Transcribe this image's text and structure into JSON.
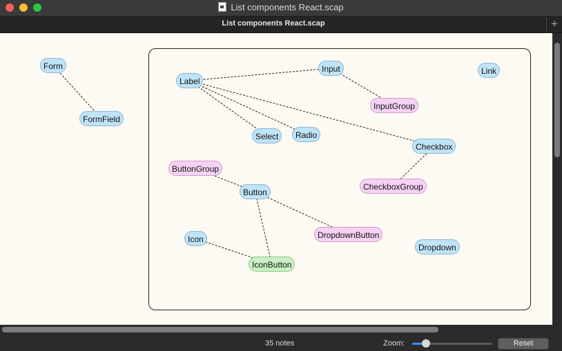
{
  "window": {
    "title": "List components React.scap",
    "controls": {
      "close": "#ff5f57",
      "minimize": "#febc2e",
      "maximize": "#28c840"
    }
  },
  "tabs": [
    {
      "label": "List components React.scap",
      "active": true
    }
  ],
  "tab_add_label": "+",
  "canvas": {
    "notes": [
      {
        "id": "form",
        "label": "Form",
        "color": "blue"
      },
      {
        "id": "formfield",
        "label": "FormField",
        "color": "blue"
      },
      {
        "id": "label",
        "label": "Label",
        "color": "blue"
      },
      {
        "id": "input",
        "label": "Input",
        "color": "blue"
      },
      {
        "id": "link",
        "label": "Link",
        "color": "blue"
      },
      {
        "id": "inputgroup",
        "label": "InputGroup",
        "color": "pink"
      },
      {
        "id": "select",
        "label": "Select",
        "color": "blue"
      },
      {
        "id": "radio",
        "label": "Radio",
        "color": "blue"
      },
      {
        "id": "checkbox",
        "label": "Checkbox",
        "color": "blue"
      },
      {
        "id": "buttongroup",
        "label": "ButtonGroup",
        "color": "pink"
      },
      {
        "id": "checkboxgroup",
        "label": "CheckboxGroup",
        "color": "pink"
      },
      {
        "id": "button",
        "label": "Button",
        "color": "blue"
      },
      {
        "id": "dropdownbutton",
        "label": "DropdownButton",
        "color": "pink"
      },
      {
        "id": "icon",
        "label": "Icon",
        "color": "blue"
      },
      {
        "id": "dropdown",
        "label": "Dropdown",
        "color": "blue"
      },
      {
        "id": "iconbutton",
        "label": "IconButton",
        "color": "green"
      }
    ],
    "links": [
      [
        "form",
        "formfield"
      ],
      [
        "label",
        "input"
      ],
      [
        "input",
        "inputgroup"
      ],
      [
        "label",
        "select"
      ],
      [
        "label",
        "radio"
      ],
      [
        "label",
        "checkbox"
      ],
      [
        "checkbox",
        "checkboxgroup"
      ],
      [
        "buttongroup",
        "button"
      ],
      [
        "button",
        "dropdownbutton"
      ],
      [
        "button",
        "iconbutton"
      ],
      [
        "icon",
        "iconbutton"
      ]
    ],
    "colors": {
      "blue": "#bfe3f7",
      "pink": "#f5d2f3",
      "green": "#c9efc3",
      "background": "#fdfaf3"
    }
  },
  "status": {
    "notes_count": "35 notes",
    "zoom_label": "Zoom:",
    "zoom_level": 0.17,
    "reset_label": "Reset"
  }
}
